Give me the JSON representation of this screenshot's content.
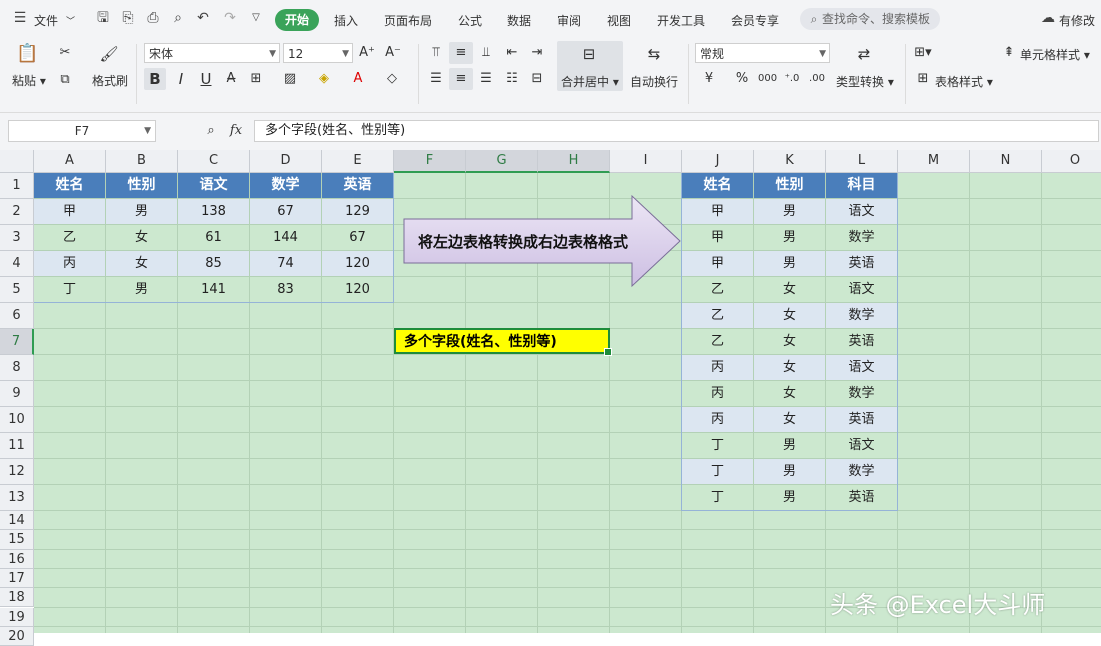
{
  "menubar": {
    "file_label": "文件",
    "tabs": [
      "开始",
      "插入",
      "页面布局",
      "公式",
      "数据",
      "审阅",
      "视图",
      "开发工具",
      "会员专享"
    ],
    "search_placeholder": "查找命令、搜索模板",
    "modified_label": "有修改"
  },
  "ribbon": {
    "paste_label": "粘贴",
    "format_painter_label": "格式刷",
    "font_name": "宋体",
    "font_size": "12",
    "bold": "B",
    "italic": "I",
    "underline": "U",
    "merge_center_label": "合并居中",
    "wrap_text_label": "自动换行",
    "number_format": "常规",
    "currency_symbol": "¥",
    "percent_symbol": "%",
    "thousands_symbol": "000",
    "type_convert_label": "类型转换",
    "cell_style_label": "单元格样式",
    "table_style_label": "表格样式"
  },
  "formula_bar": {
    "cell_ref": "F7",
    "fx_label": "fx",
    "content": "多个字段(姓名、性别等)"
  },
  "columns": [
    "A",
    "B",
    "C",
    "D",
    "E",
    "F",
    "G",
    "H",
    "I",
    "J",
    "K",
    "L",
    "M",
    "N",
    "O"
  ],
  "rows": [
    "1",
    "2",
    "3",
    "4",
    "5",
    "6",
    "7",
    "8",
    "9",
    "10",
    "11",
    "12",
    "13",
    "14",
    "15",
    "16",
    "17",
    "18",
    "19",
    "20"
  ],
  "left_table": {
    "headers": [
      "姓名",
      "性别",
      "语文",
      "数学",
      "英语"
    ],
    "rows": [
      [
        "甲",
        "男",
        "138",
        "67",
        "129"
      ],
      [
        "乙",
        "女",
        "61",
        "144",
        "67"
      ],
      [
        "丙",
        "女",
        "85",
        "74",
        "120"
      ],
      [
        "丁",
        "男",
        "141",
        "83",
        "120"
      ]
    ]
  },
  "arrow_text": "将左边表格转换成右边表格格式",
  "active_cell_text": "多个字段(姓名、性别等)",
  "right_table": {
    "headers": [
      "姓名",
      "性别",
      "科目"
    ],
    "rows": [
      [
        "甲",
        "男",
        "语文"
      ],
      [
        "甲",
        "男",
        "数学"
      ],
      [
        "甲",
        "男",
        "英语"
      ],
      [
        "乙",
        "女",
        "语文"
      ],
      [
        "乙",
        "女",
        "数学"
      ],
      [
        "乙",
        "女",
        "英语"
      ],
      [
        "丙",
        "女",
        "语文"
      ],
      [
        "丙",
        "女",
        "数学"
      ],
      [
        "丙",
        "女",
        "英语"
      ],
      [
        "丁",
        "男",
        "语文"
      ],
      [
        "丁",
        "男",
        "数学"
      ],
      [
        "丁",
        "男",
        "英语"
      ]
    ]
  },
  "watermark": "头条 @Excel大斗师",
  "colors": {
    "sheet_bg": "#cce8cf",
    "table_header": "#4a7ebb",
    "table_alt_row": "#dce6f1",
    "accent_green": "#3aa35a",
    "active_cell_fill": "#ffff00",
    "arrow_fill": "#dcd0ec"
  }
}
